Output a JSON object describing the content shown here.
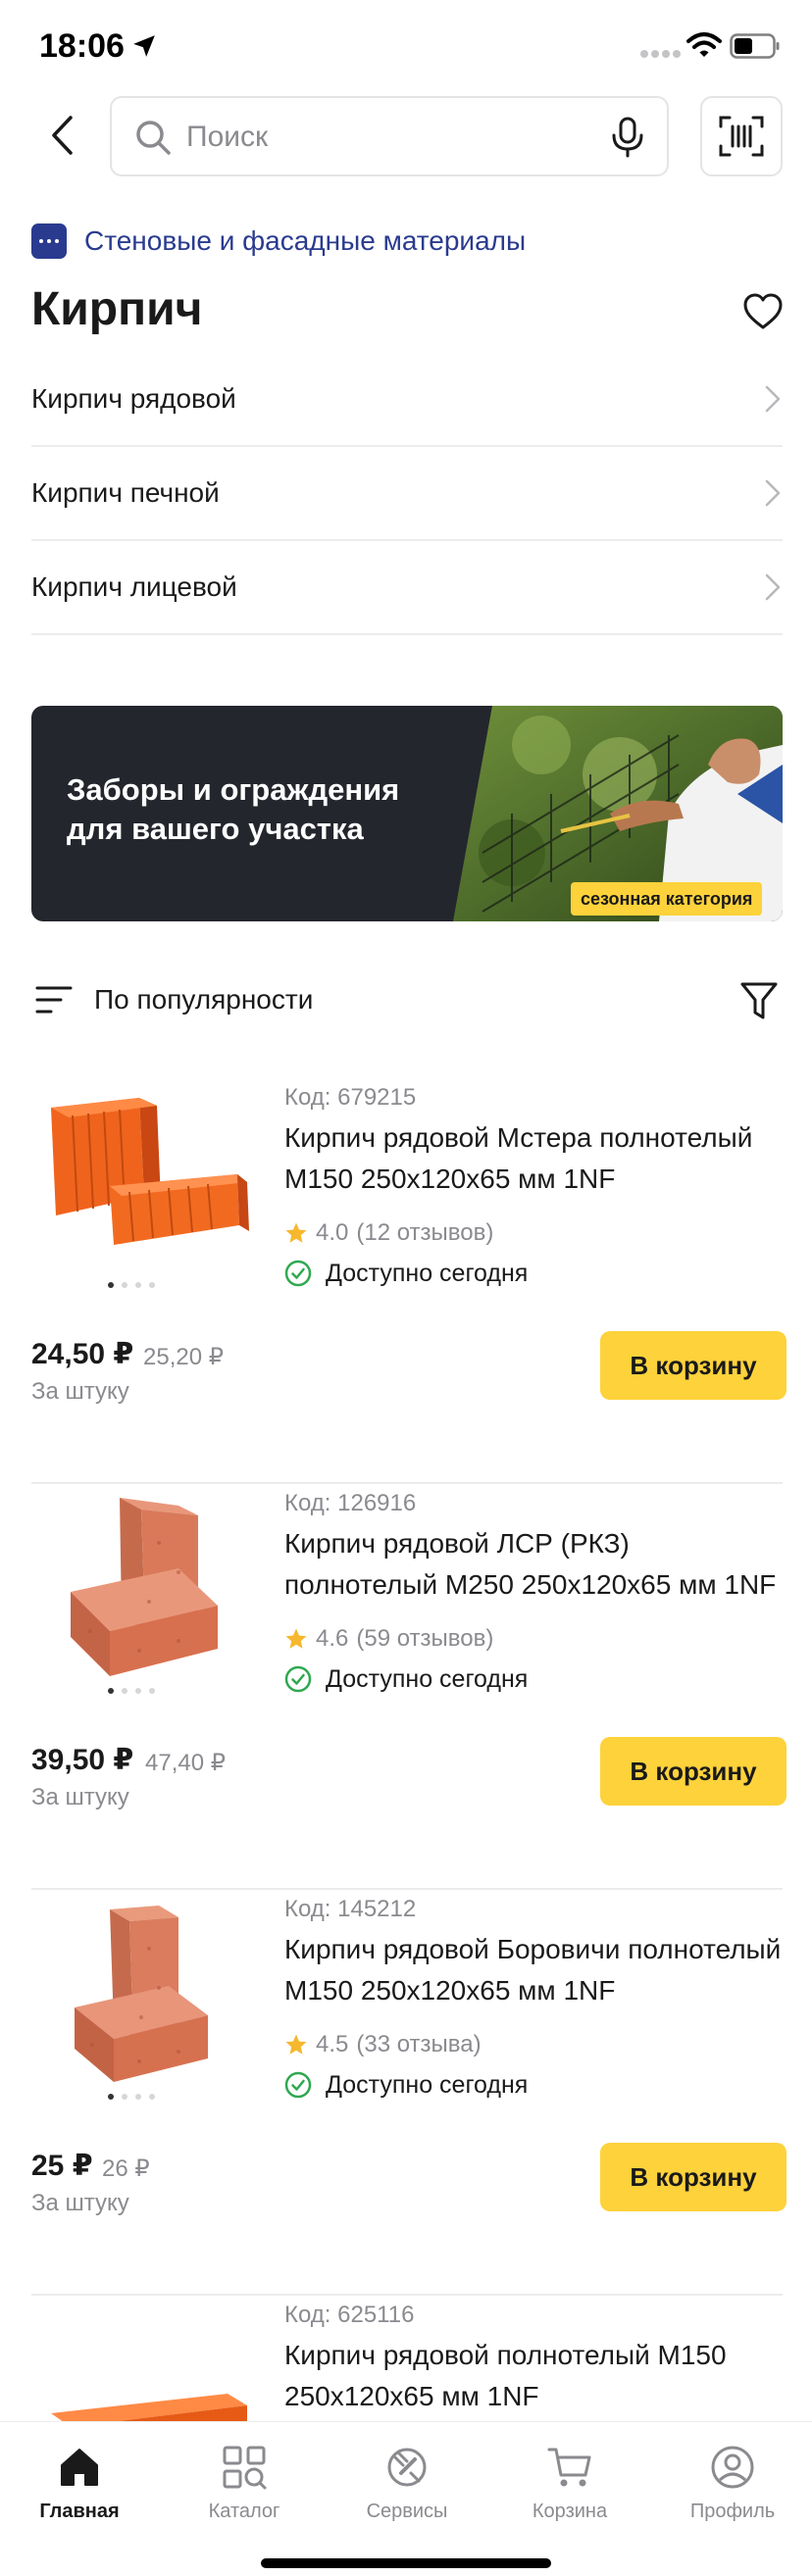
{
  "status_bar": {
    "time": "18:06"
  },
  "search": {
    "placeholder": "Поиск"
  },
  "breadcrumb": {
    "label": "Стеновые и фасадные материалы"
  },
  "page_title": "Кирпич",
  "categories": [
    {
      "label": "Кирпич рядовой"
    },
    {
      "label": "Кирпич печной"
    },
    {
      "label": "Кирпич лицевой"
    }
  ],
  "banner": {
    "line1": "Заборы и ограждения",
    "line2": "для вашего участка",
    "tag": "сезонная категория"
  },
  "sort": {
    "label": "По популярности"
  },
  "products": [
    {
      "code": "Код: 679215",
      "name": "Кирпич рядовой Мстера полнотелый М150 250х120х65 мм 1NF",
      "rating": "4.0",
      "reviews": "(12 отзывов)",
      "availability": "Доступно сегодня",
      "price": "24,50 ₽",
      "old_price": "25,20 ₽",
      "unit": "За штуку",
      "cart_label": "В корзину",
      "image_dots": 4,
      "image_index": 0
    },
    {
      "code": "Код: 126916",
      "name": "Кирпич рядовой ЛСР (РКЗ) полнотелый М250 250х120х65 мм 1NF",
      "rating": "4.6",
      "reviews": "(59 отзывов)",
      "availability": "Доступно сегодня",
      "price": "39,50 ₽",
      "old_price": "47,40 ₽",
      "unit": "За штуку",
      "cart_label": "В корзину",
      "image_dots": 4,
      "image_index": 0
    },
    {
      "code": "Код: 145212",
      "name": "Кирпич рядовой Боровичи полнотелый М150 250х120х65 мм 1NF",
      "rating": "4.5",
      "reviews": "(33 отзыва)",
      "availability": "Доступно сегодня",
      "price": "25 ₽",
      "old_price": "26 ₽",
      "unit": "За штуку",
      "cart_label": "В корзину",
      "image_dots": 4,
      "image_index": 0
    },
    {
      "code": "Код: 625116",
      "name": "Кирпич рядовой полнотелый М150 250х120х65 мм 1NF"
    }
  ],
  "nav": [
    {
      "label": "Главная",
      "icon": "home-icon",
      "active": true
    },
    {
      "label": "Каталог",
      "icon": "catalog-icon",
      "active": false
    },
    {
      "label": "Сервисы",
      "icon": "services-icon",
      "active": false
    },
    {
      "label": "Корзина",
      "icon": "cart-icon",
      "active": false
    },
    {
      "label": "Профиль",
      "icon": "profile-icon",
      "active": false
    }
  ],
  "colors": {
    "accent_yellow": "#fdd23b",
    "brand_blue": "#2a3b8f",
    "available_green": "#2fa84f",
    "star": "#f5b82e",
    "banner_bg": "#24262d"
  }
}
